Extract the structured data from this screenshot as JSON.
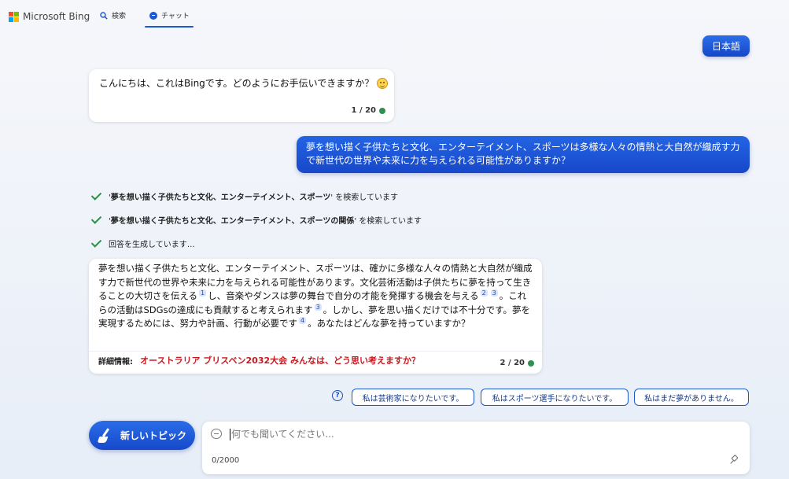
{
  "header": {
    "logo_text": "Microsoft Bing",
    "nav": [
      {
        "label": "検索",
        "icon": "search-icon"
      },
      {
        "label": "チャット",
        "icon": "chat-icon",
        "active": true
      }
    ],
    "logo_colors": [
      "#f25022",
      "#7fba00",
      "#00a4ef",
      "#ffb900"
    ]
  },
  "language_button": "日本語",
  "conversation": {
    "bot_greeting": {
      "text": "こんにちは、これはBingです。どのようにお手伝いできますか？",
      "counter": "1 / 20"
    },
    "user_message": "夢を想い描く子供たちと文化、エンターテイメント、スポーツは多様な人々の情熱と大自然が織成す力で新世代の世界や未来に力を与えられる可能性がありますか？",
    "status_steps": [
      {
        "prefix": "'",
        "query": "夢を想い描く子供たちと文化、エンターテイメント、スポーツ",
        "suffix": "' を検索しています"
      },
      {
        "prefix": "'",
        "query": "夢を想い描く子供たちと文化、エンターテイメント、スポーツの関係",
        "suffix": "' を検索しています"
      },
      {
        "prefix": "",
        "query": "",
        "suffix": "回答を生成しています…"
      }
    ],
    "bot_answer": {
      "segments": [
        "夢を想い描く子供たちと文化、エンターテイメント、スポーツは、確かに多様な人々の情熱と大自然が織成す力で新世代の世界や未来に力を与えられる可能性があります。文化芸術活動は子供たちに夢を持って生きることの大切さを伝える",
        "し、音楽やダンスは夢の舞台で自分の才能を発揮する機会を与える",
        "。これらの活動はSDGsの達成にも貢献すると考えられます",
        "。しかし、夢を思い描くだけでは不十分です。夢を実現するためには、努力や計画、行動が必要です",
        "。あなたはどんな夢を持っていますか？"
      ],
      "citations": [
        "1",
        "2",
        "3",
        "3",
        "4"
      ],
      "learn_more_label": "詳細情報:",
      "learn_more_link": "オーストラリア ブリスベン2032大会 みんなは、どう思い考えますか？",
      "counter": "2 / 20"
    }
  },
  "suggestions": [
    "私は芸術家になりたいです。",
    "私はスポーツ選手になりたいです。",
    "私はまだ夢がありません。"
  ],
  "help_icon_glyph": "?",
  "new_topic_label": "新しいトピック",
  "input": {
    "placeholder": "何でも聞いてください...",
    "char_count": "0/2000"
  }
}
